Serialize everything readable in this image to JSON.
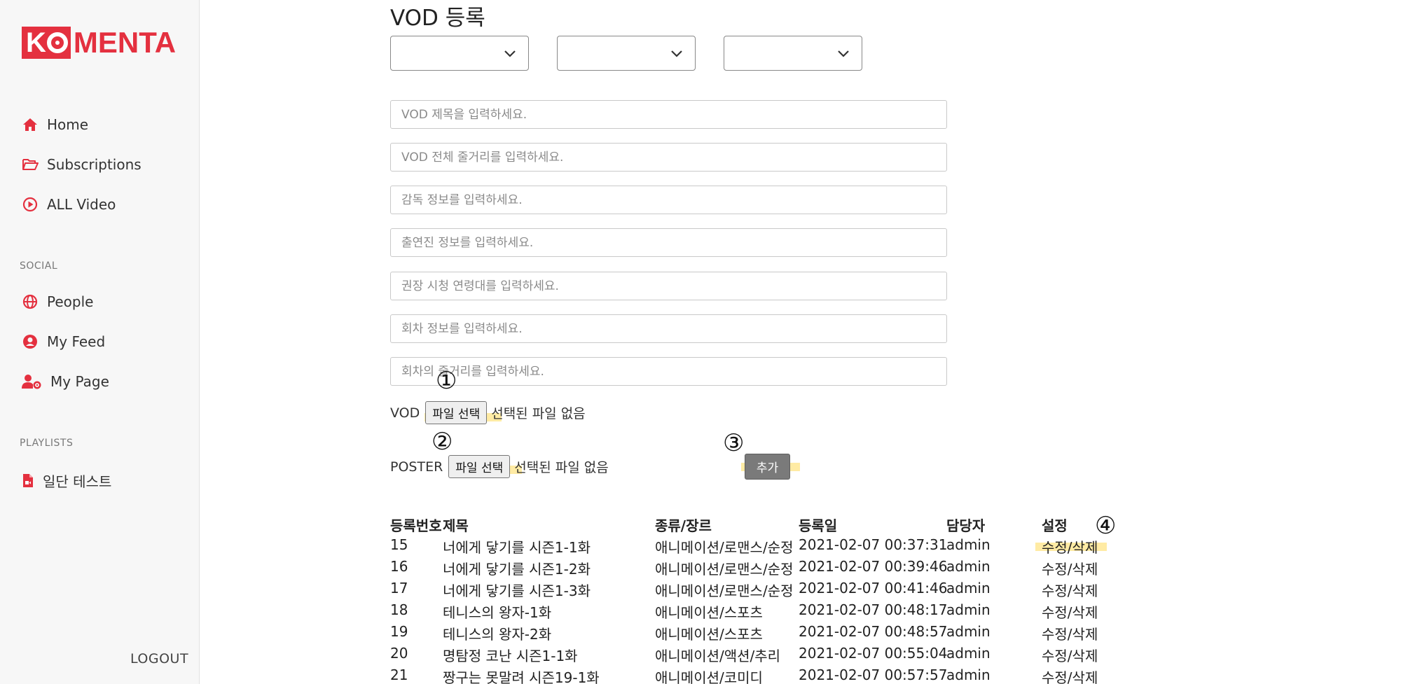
{
  "brand": {
    "logo_ko": "K",
    "logo_rest": "MENTA",
    "color": "#e4303f"
  },
  "sidebar": {
    "nav": [
      {
        "label": "Home",
        "icon": "home-icon"
      },
      {
        "label": "Subscriptions",
        "icon": "folder-open-icon"
      },
      {
        "label": "ALL Video",
        "icon": "play-circle-icon"
      }
    ],
    "social_label": "SOCIAL",
    "social": [
      {
        "label": "People",
        "icon": "globe-icon"
      },
      {
        "label": "My Feed",
        "icon": "user-circle-icon"
      },
      {
        "label": "My Page",
        "icon": "user-cog-icon"
      }
    ],
    "playlists_label": "PLAYLISTS",
    "playlists": [
      {
        "label": "일단 테스트",
        "icon": "file-video-icon"
      }
    ],
    "logout": "LOGOUT"
  },
  "form": {
    "title": "VOD 등록",
    "selects": [
      "",
      "",
      ""
    ],
    "inputs": [
      {
        "placeholder": "VOD 제목을 입력하세요.",
        "value": ""
      },
      {
        "placeholder": "VOD 전체 줄거리를 입력하세요.",
        "value": ""
      },
      {
        "placeholder": "감독 정보를 입력하세요.",
        "value": ""
      },
      {
        "placeholder": "출연진 정보를 입력하세요.",
        "value": ""
      },
      {
        "placeholder": "권장 시청 연령대를 입력하세요.",
        "value": ""
      },
      {
        "placeholder": "회차 정보를 입력하세요.",
        "value": ""
      },
      {
        "placeholder": "회차의 줄거리를 입력하세요.",
        "value": ""
      }
    ],
    "vod_label": "VOD",
    "poster_label": "POSTER",
    "file_button": "파일 선택",
    "no_file": "선택된 파일 없음",
    "add_button": "추가",
    "markers": [
      "①",
      "②",
      "③",
      "④"
    ]
  },
  "table": {
    "headers": [
      "등록번호",
      "제목",
      "종류/장르",
      "등록일",
      "담당자",
      "설정"
    ],
    "rows": [
      [
        "15",
        "너에게 닿기를 시즌1-1화",
        "애니메이션/로맨스/순정",
        "2021-02-07 00:37:31",
        "admin",
        "수정/삭제"
      ],
      [
        "16",
        "너에게 닿기를 시즌1-2화",
        "애니메이션/로맨스/순정",
        "2021-02-07 00:39:46",
        "admin",
        "수정/삭제"
      ],
      [
        "17",
        "너에게 닿기를 시즌1-3화",
        "애니메이션/로맨스/순정",
        "2021-02-07 00:41:46",
        "admin",
        "수정/삭제"
      ],
      [
        "18",
        "테니스의 왕자-1화",
        "애니메이션/스포츠",
        "2021-02-07 00:48:17",
        "admin",
        "수정/삭제"
      ],
      [
        "19",
        "테니스의 왕자-2화",
        "애니메이션/스포츠",
        "2021-02-07 00:48:57",
        "admin",
        "수정/삭제"
      ],
      [
        "20",
        "명탐정 코난 시즌1-1화",
        "애니메이션/액션/추리",
        "2021-02-07 00:55:04",
        "admin",
        "수정/삭제"
      ],
      [
        "21",
        "짱구는 못말려 시즌19-1화",
        "애니메이션/코미디",
        "2021-02-07 00:57:57",
        "admin",
        "수정/삭제"
      ]
    ]
  },
  "colors": {
    "highlight": "#ffdb5a",
    "add_button": "#7a7a7a",
    "icon_red": "#e4303f"
  }
}
